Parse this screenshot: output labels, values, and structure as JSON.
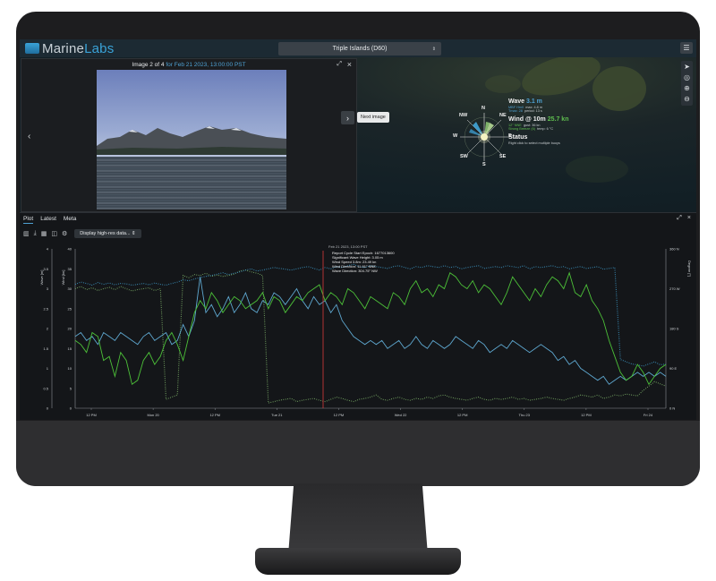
{
  "app": {
    "logo_a": "Marine",
    "logo_b": "Labs",
    "station": "Triple Islands (D60)",
    "menu_icon": "hamburger-icon"
  },
  "image_panel": {
    "title_prefix": "Image 2 of 4",
    "title_suffix": "for Feb 21 2023, 13:00:00 PST",
    "next_tooltip": "Next image"
  },
  "compass": {
    "labels": {
      "n": "N",
      "ne": "NE",
      "e": "E",
      "se": "SE",
      "s": "S",
      "sw": "SW",
      "w": "W",
      "nw": "NW"
    }
  },
  "conditions": {
    "wave_label": "Wave",
    "wave_value": "3.1 m",
    "wave_sub_a": "MBF Hm0",
    "wave_sub_b": "max: 4.8 m",
    "wave_sub_c": "Tmax: 28",
    "wave_sub_d": "period: 13 s",
    "wind_label": "Wind @ 10m",
    "wind_value": "25.7 kn",
    "wind_sub_a": "12° NNE",
    "wind_sub_b": "gust: 36 kn",
    "wind_sub_c": "Strong Breeze (6)",
    "wind_sub_d": "temp: 6 °C",
    "status_label": "Status",
    "status_sub": "Right click to select multiple buoys"
  },
  "plot_panel": {
    "tabs": [
      "Plot",
      "Latest",
      "Meta"
    ],
    "active_tab": "Plot",
    "data_select": "Display high-res data..."
  },
  "chart_data": {
    "type": "line",
    "annotation": {
      "date": "Feb 21 2023, 13:00 PST",
      "lines": [
        "Report Cycle Start Epoch: 1677013600",
        "Significant Wave Height: 3.05 m",
        "Wind Speed 3.8m: 23.49 kn",
        "Wind Direction: 11.91° NNE",
        "Wave Direction: 304.75° NW"
      ]
    },
    "x_ticks": [
      "12 PM",
      "Mon 20",
      "12 PM",
      "Tue 21",
      "12 PM",
      "Wed 22",
      "12 PM",
      "Thu 23",
      "12 PM",
      "Fri 24"
    ],
    "axis_left_1": {
      "label": "Wave [m]",
      "ticks": [
        "0",
        "0.5",
        "1",
        "1.5",
        "2",
        "2.5",
        "3",
        "3.5",
        "4"
      ],
      "ylim": [
        0,
        4
      ]
    },
    "axis_left_2": {
      "label": "Wind [kn]",
      "ticks": [
        "0",
        "5",
        "10",
        "15",
        "20",
        "25",
        "30",
        "35",
        "40"
      ],
      "ylim": [
        0,
        40
      ]
    },
    "axis_right": {
      "label": "Degree [°]",
      "ticks": [
        "0 N",
        "90 E",
        "180 S",
        "270 W",
        "360 N"
      ],
      "ylim": [
        0,
        360
      ]
    },
    "series": [
      {
        "name": "Wind",
        "color": "#4cc038",
        "values": [
          17,
          16,
          14,
          19,
          18,
          12,
          13,
          8,
          14,
          12,
          6,
          7,
          12,
          14,
          11,
          13,
          17,
          19,
          16,
          12,
          18,
          24,
          27,
          25,
          29,
          27,
          24,
          26,
          28,
          27,
          25,
          26,
          27,
          29,
          25,
          28,
          27,
          24,
          26,
          28,
          27,
          29,
          30,
          31,
          27,
          29,
          28,
          26,
          30,
          29,
          27,
          25,
          28,
          27,
          26,
          25,
          29,
          28,
          26,
          30,
          32,
          29,
          30,
          28,
          31,
          30,
          34,
          33,
          31,
          30,
          32,
          29,
          31,
          30,
          28,
          26,
          29,
          33,
          31,
          29,
          27,
          30,
          28,
          31,
          33,
          32,
          30,
          34,
          29,
          28,
          31,
          27,
          25,
          22,
          17,
          13,
          9,
          7,
          8,
          11,
          9,
          6,
          8,
          10,
          11
        ]
      },
      {
        "name": "Wave",
        "color": "#5ea7cf",
        "values": [
          1.8,
          1.9,
          1.7,
          1.8,
          1.6,
          1.9,
          1.8,
          1.7,
          1.9,
          1.8,
          1.7,
          1.6,
          1.8,
          1.9,
          1.7,
          1.8,
          1.9,
          1.6,
          1.7,
          2.1,
          1.8,
          2.2,
          3.3,
          2.4,
          2.6,
          2.3,
          2.5,
          2.8,
          2.4,
          2.6,
          2.9,
          2.5,
          2.4,
          2.7,
          2.6,
          2.9,
          2.8,
          2.6,
          2.8,
          3.0,
          2.7,
          2.5,
          2.8,
          2.6,
          2.7,
          2.4,
          2.6,
          2.2,
          2.0,
          1.8,
          1.7,
          1.6,
          1.7,
          1.6,
          1.7,
          1.5,
          1.6,
          1.7,
          1.5,
          1.6,
          1.8,
          1.6,
          1.5,
          1.7,
          1.6,
          1.5,
          1.6,
          1.8,
          1.7,
          1.6,
          1.5,
          1.7,
          1.6,
          1.4,
          1.5,
          1.6,
          1.5,
          1.7,
          1.6,
          1.5,
          1.4,
          1.5,
          1.6,
          1.5,
          1.4,
          1.2,
          1.3,
          1.1,
          1.2,
          1.0,
          0.9,
          0.8,
          0.7,
          0.8,
          0.6,
          0.7,
          0.8,
          0.7,
          0.8,
          0.9,
          0.8,
          0.9,
          0.8,
          0.9,
          0.8
        ]
      },
      {
        "name": "Wind Direction",
        "color": "#7fb36a",
        "values": [
          270,
          275,
          268,
          272,
          266,
          270,
          273,
          268,
          275,
          270,
          265,
          268,
          270,
          272,
          266,
          270,
          20,
          25,
          30,
          300,
          295,
          302,
          300,
          305,
          298,
          301,
          298,
          300,
          303,
          310,
          312,
          308,
          305,
          300,
          12,
          15,
          18,
          20,
          22,
          15,
          18,
          20,
          22,
          18,
          15,
          20,
          25,
          22,
          18,
          15,
          20,
          22,
          25,
          30,
          20,
          18,
          22,
          25,
          20,
          18,
          22,
          20,
          25,
          22,
          28,
          30,
          25,
          22,
          20,
          18,
          22,
          25,
          20,
          18,
          22,
          20,
          22,
          25,
          20,
          22,
          18,
          20,
          22,
          25,
          22,
          20,
          18,
          22,
          25,
          30,
          28,
          25,
          30,
          22,
          25,
          30,
          28,
          32,
          30,
          28,
          40,
          50,
          60,
          55,
          50
        ]
      },
      {
        "name": "Wave Direction",
        "color": "#3d9ac9",
        "values": [
          280,
          285,
          282,
          278,
          284,
          280,
          283,
          279,
          282,
          281,
          278,
          280,
          282,
          279,
          283,
          280,
          278,
          282,
          285,
          290,
          288,
          292,
          295,
          298,
          300,
          303,
          306,
          302,
          305,
          308,
          312,
          315,
          310,
          312,
          315,
          318,
          316,
          314,
          312,
          315,
          318,
          320,
          316,
          312,
          318,
          315,
          320,
          318,
          322,
          325,
          320,
          318,
          322,
          320,
          318,
          316,
          320,
          322,
          318,
          315,
          320,
          318,
          322,
          320,
          318,
          322,
          318,
          320,
          315,
          318,
          320,
          322,
          316,
          318,
          320,
          318,
          322,
          320,
          318,
          322,
          315,
          320,
          318,
          320,
          322,
          318,
          320,
          315,
          318,
          320,
          316,
          318,
          320,
          314,
          316,
          318,
          110,
          105,
          100,
          98,
          95,
          100,
          105,
          98,
          100
        ]
      }
    ]
  }
}
